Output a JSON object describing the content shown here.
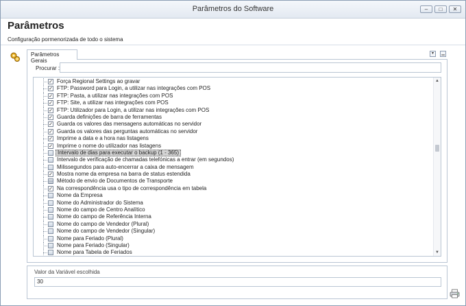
{
  "window": {
    "title": "Parâmetros do Software",
    "minimize_glyph": "–",
    "maximize_glyph": "□",
    "close_glyph": "✕"
  },
  "header": {
    "title": "Parâmetros",
    "subtitle": "Configuração pormenorizada de todo o sistema"
  },
  "tabs": [
    {
      "label": "Parâmetros Gerais"
    }
  ],
  "tabstrip": {
    "pin_glyph": "▾",
    "close_glyph": "▁"
  },
  "search": {
    "label": "Procurar :",
    "value": ""
  },
  "tree": {
    "rows": [
      {
        "type": "check",
        "checked": true,
        "label": "Força Regional Settings ao gravar"
      },
      {
        "type": "check",
        "checked": true,
        "label": "FTP: Password para Login, a utilizar nas integrações com POS"
      },
      {
        "type": "check",
        "checked": true,
        "label": "FTP: Pasta, a utilizar nas integrações com POS"
      },
      {
        "type": "check",
        "checked": true,
        "label": "FTP: Site, a utilizar nas integrações com POS"
      },
      {
        "type": "check",
        "checked": true,
        "label": "FTP: Utilizador para Login, a utilizar nas integrações com POS"
      },
      {
        "type": "check",
        "checked": true,
        "label": "Guarda definições de barra de ferramentas"
      },
      {
        "type": "check",
        "checked": true,
        "label": "Guarda os valores das mensagens automáticas no servidor"
      },
      {
        "type": "check",
        "checked": true,
        "label": "Guarda os valores das perguntas automáticas no servidor"
      },
      {
        "type": "check",
        "checked": true,
        "label": "Imprime a data e a hora nas listagens"
      },
      {
        "type": "check",
        "checked": true,
        "label": "Imprime o nome do utilizador nas listagens"
      },
      {
        "type": "field",
        "checked": false,
        "label": "Intervalo de dias para executar o backup (1 - 365)",
        "selected": true
      },
      {
        "type": "field",
        "checked": false,
        "label": "Intervalo de verificação de chamadas telefónicas a entrar (em segundos)"
      },
      {
        "type": "field",
        "checked": false,
        "label": "Milissegundos para auto-encerrar a caixa de mensagem"
      },
      {
        "type": "check",
        "checked": true,
        "label": "Mostra nome da empresa na barra de status estendida"
      },
      {
        "type": "list",
        "checked": false,
        "label": "Método de envio de Documentos de Transporte"
      },
      {
        "type": "check",
        "checked": true,
        "label": "Na correspondência usa o tipo de correspondência em tabela"
      },
      {
        "type": "field",
        "checked": false,
        "label": "Nome da Empresa"
      },
      {
        "type": "field",
        "checked": false,
        "label": "Nome do Administrador do Sistema"
      },
      {
        "type": "field",
        "checked": false,
        "label": "Nome do campo de Centro Analítico"
      },
      {
        "type": "field",
        "checked": false,
        "label": "Nome do campo de Referência Interna"
      },
      {
        "type": "field",
        "checked": false,
        "label": "Nome do campo de Vendedor (Plural)"
      },
      {
        "type": "field",
        "checked": false,
        "label": "Nome do campo de Vendedor (Singular)"
      },
      {
        "type": "field",
        "checked": false,
        "label": "Nome para Feriado (Plural)"
      },
      {
        "type": "field",
        "checked": false,
        "label": "Nome para Feriado (Singular)"
      },
      {
        "type": "field",
        "checked": false,
        "label": "Nome para Tabela de Feriados"
      }
    ],
    "scroll_position": 0.38
  },
  "scrollbar": {
    "up_glyph": "▲",
    "down_glyph": "▼"
  },
  "value_panel": {
    "label": "Valor da Variável escolhida",
    "value": "30"
  }
}
